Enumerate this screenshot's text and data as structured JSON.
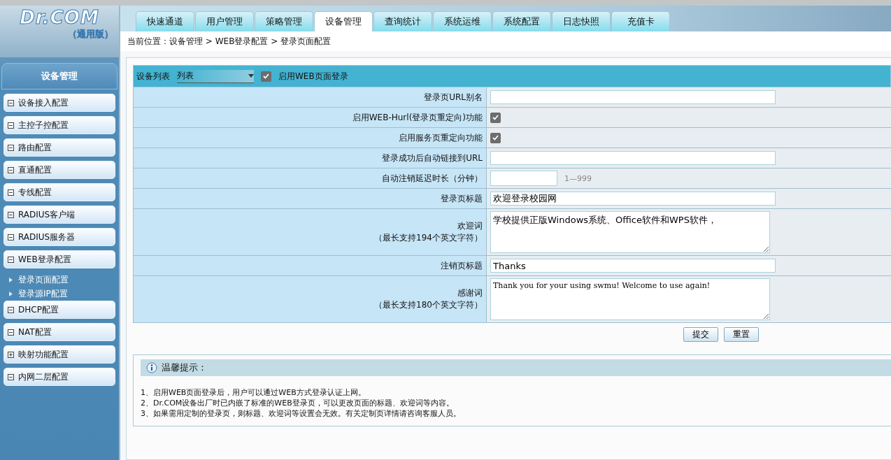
{
  "logo": {
    "brand": "Dr.COM",
    "edition": "（通用版）"
  },
  "tabs": [
    {
      "label": "快速通道",
      "selected": false
    },
    {
      "label": "用户管理",
      "selected": false
    },
    {
      "label": "策略管理",
      "selected": false
    },
    {
      "label": "设备管理",
      "selected": true
    },
    {
      "label": "查询统计",
      "selected": false
    },
    {
      "label": "系统运维",
      "selected": false
    },
    {
      "label": "系统配置",
      "selected": false
    },
    {
      "label": "日志快照",
      "selected": false
    },
    {
      "label": "充值卡",
      "selected": false
    }
  ],
  "breadcrumb": "当前位置：设备管理 > WEB登录配置 > 登录页面配置",
  "sidebar": {
    "title": "设备管理",
    "items": [
      {
        "label": "设备接入配置",
        "expanded": true
      },
      {
        "label": "主控子控配置",
        "expanded": true
      },
      {
        "label": "路由配置",
        "expanded": true
      },
      {
        "label": "直通配置",
        "expanded": true
      },
      {
        "label": "专线配置",
        "expanded": true
      },
      {
        "label": "RADIUS客户端",
        "expanded": true
      },
      {
        "label": "RADIUS服务器",
        "expanded": true
      },
      {
        "label": "WEB登录配置",
        "expanded": true,
        "children": [
          {
            "label": "登录页面配置"
          },
          {
            "label": "登录源IP配置"
          }
        ]
      },
      {
        "label": "DHCP配置",
        "expanded": true
      },
      {
        "label": "NAT配置",
        "expanded": true
      },
      {
        "label": "映射功能配置",
        "expanded": false
      },
      {
        "label": "内网二层配置",
        "expanded": true
      }
    ]
  },
  "form_header": {
    "device_label": "设备列表",
    "device_value": "列表",
    "enable_label": "启用WEB页面登录",
    "enable_checked": true
  },
  "form_rows": [
    {
      "kind": "input",
      "label": "登录页URL别名"
    },
    {
      "kind": "checkbox",
      "label": "启用WEB-Hurl(登录页重定向)功能",
      "checked": true
    },
    {
      "kind": "checkbox",
      "label": "启用服务页重定向功能",
      "checked": true
    },
    {
      "kind": "input",
      "label": "登录成功后自动链接到URL"
    },
    {
      "kind": "short",
      "label": "自动注销延迟时长（分钟）",
      "hint": "1—999"
    },
    {
      "kind": "input",
      "label": "登录页标题",
      "value": "欢迎登录校园网"
    },
    {
      "kind": "textarea",
      "label": "欢迎词",
      "note": "（最长支持194个英文字符）",
      "value": "学校提供正版Windows系统、Office软件和WPS软件，"
    },
    {
      "kind": "input",
      "label": "注销页标题",
      "value": "Thanks"
    },
    {
      "kind": "textarea",
      "label": "感谢词",
      "note": "（最长支持180个英文字符）",
      "value": "Thank you for your using swmu! Welcome to use again!",
      "mono": true
    }
  ],
  "buttons": [
    "提交",
    "重置"
  ],
  "tips": {
    "title": "温馨提示：",
    "lines": [
      "1、启用WEB页面登录后，用户可以通过WEB方式登录认证上网。",
      "2、Dr.COM设备出厂时已内嵌了标准的WEB登录页，可以更改页面的标题、欢迎词等内容。",
      "3、如果需用定制的登录页，则标题、欢迎词等设置会无效。有关定制页详情请咨询客服人员。"
    ]
  }
}
